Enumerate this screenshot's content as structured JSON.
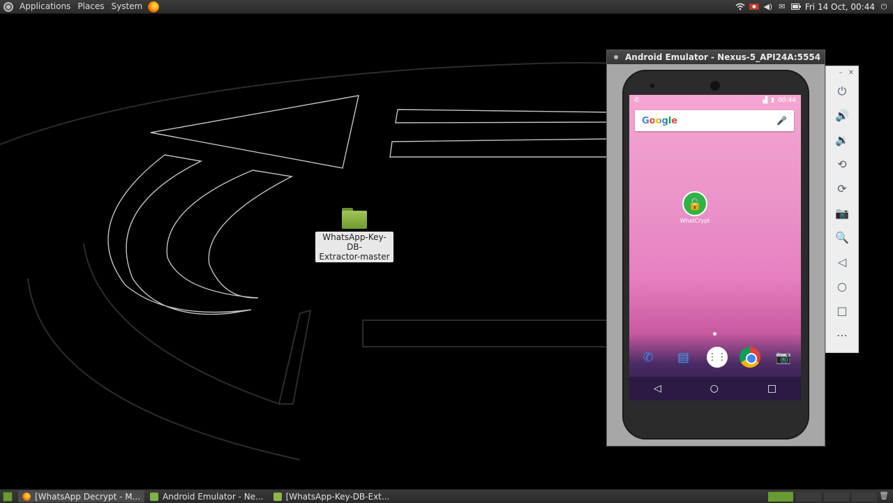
{
  "top_panel": {
    "menus": [
      "Applications",
      "Places",
      "System"
    ],
    "clock": "Fri 14 Oct, 00:44",
    "tray_icons": [
      "wifi-icon",
      "record-icon",
      "volume-icon",
      "mail-icon",
      "battery-icon",
      "power-icon"
    ]
  },
  "desktop": {
    "folder_label_line1": "WhatsApp-Key-DB-",
    "folder_label_line2": "Extractor-master"
  },
  "emulator": {
    "title": "Android Emulator - Nexus-5_API24A:5554",
    "status_time": "00:44",
    "search_logo": "Google",
    "app_label": "WhatCrypt",
    "sidebar_tools": [
      "power-icon",
      "volume-up-icon",
      "volume-down-icon",
      "rotate-left-icon",
      "rotate-right-icon",
      "camera-icon",
      "zoom-icon",
      "back-icon",
      "home-icon",
      "overview-icon",
      "more-icon"
    ]
  },
  "taskbar": {
    "tasks": [
      {
        "label": "[WhatsApp Decrypt - M...",
        "icon": "firefox-icon"
      },
      {
        "label": "Android Emulator - Ne...",
        "icon": "emulator-icon"
      },
      {
        "label": "[WhatsApp-Key-DB-Ext...",
        "icon": "folder-icon"
      }
    ]
  },
  "colors": {
    "panel": "#2e2e2e",
    "folder_green": "#8fb448",
    "whatsapp_green": "#2fb344",
    "wallpaper_pink": "#ea93c9"
  }
}
